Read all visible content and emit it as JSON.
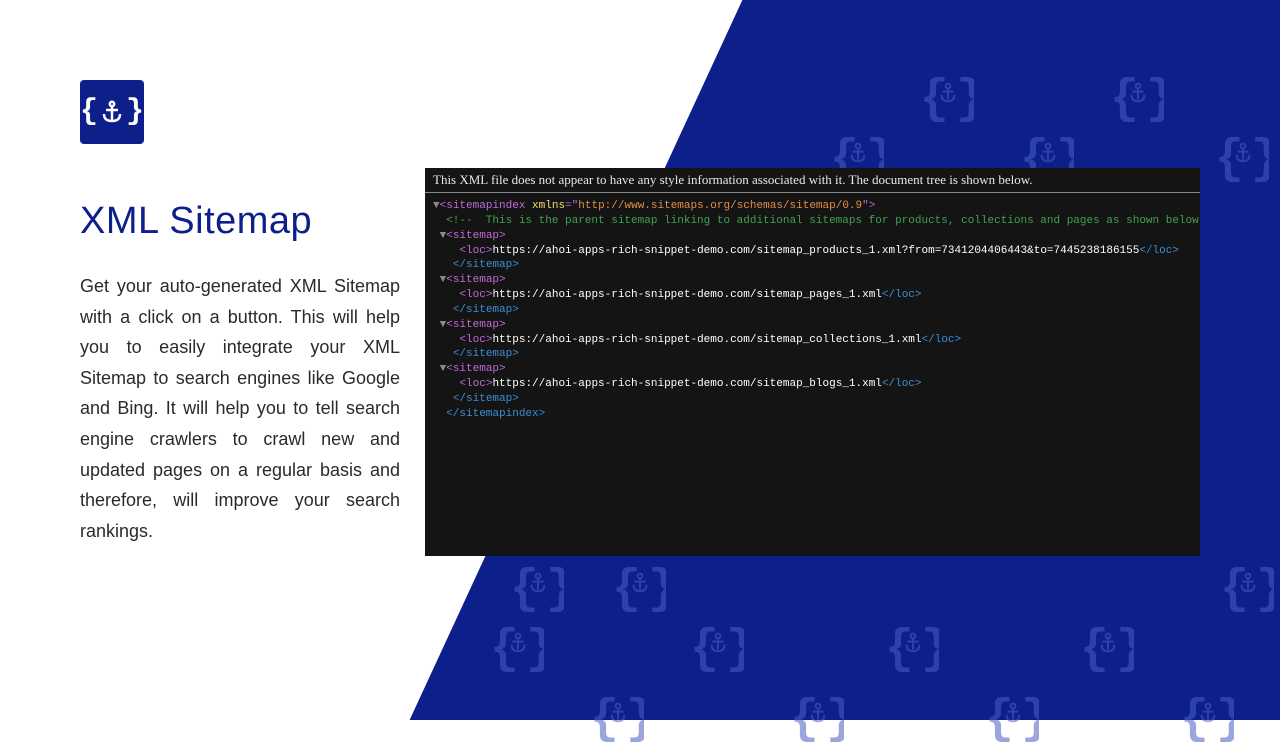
{
  "heading": "XML Sitemap",
  "body": "Get your auto-generated XML Sitemap with a click on a button. This will help you to easily integrate your XML Sitemap to search engines like Google and Bing. It will help you to tell search engine crawlers to crawl new and updated pages on a regular basis and therefore, will improve your search rankings.",
  "code_notice": "This XML file does not appear to have any style information associated with it. The document tree is shown below.",
  "xml": {
    "root_open": "<sitemapindex xmlns=\"",
    "xmlns_url": "http://www.sitemaps.org/schemas/sitemap/0.9",
    "root_open_end": "\">",
    "comment": "<!--  This is the parent sitemap linking to additional sitemaps for products, collections and pages as shown below. The sitemap can not be edited manua",
    "sitemap_open": "<sitemap>",
    "loc_open": "<loc>",
    "loc_close": "</loc>",
    "sitemap_close": "</sitemap>",
    "root_close": "</sitemapindex>",
    "urls": [
      "https://ahoi-apps-rich-snippet-demo.com/sitemap_products_1.xml?from=7341204406443&to=7445238186155",
      "https://ahoi-apps-rich-snippet-demo.com/sitemap_pages_1.xml",
      "https://ahoi-apps-rich-snippet-demo.com/sitemap_collections_1.xml",
      "https://ahoi-apps-rich-snippet-demo.com/sitemap_blogs_1.xml"
    ]
  },
  "colors": {
    "brand": "#0c1f8b",
    "pattern": "#4a5cc4"
  }
}
